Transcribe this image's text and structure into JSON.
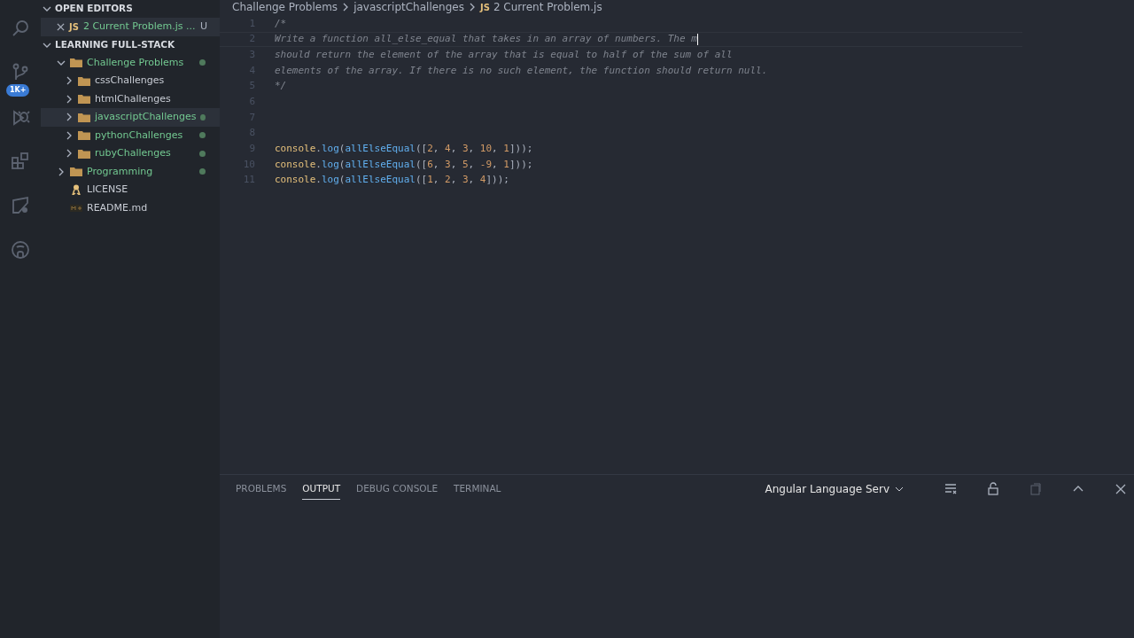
{
  "activity_bar": {
    "items": [
      {
        "kind": "search"
      },
      {
        "kind": "source-control",
        "badge": "1K+"
      },
      {
        "kind": "debug"
      },
      {
        "kind": "extensions"
      },
      {
        "kind": "remote"
      },
      {
        "kind": "github"
      }
    ]
  },
  "sidebar": {
    "open_editors": {
      "title": "OPEN EDITORS",
      "expanded": true,
      "items": [
        {
          "icon": "JS",
          "name": "2 Current Problem.js ...",
          "status": "U",
          "modified": true
        }
      ]
    },
    "explorer": {
      "title": "LEARNING FULL-STACK",
      "expanded": true,
      "items": [
        {
          "kind": "folder",
          "name": "Challenge Problems",
          "expanded": true,
          "modified": true,
          "selected": false,
          "children": [
            {
              "kind": "folder",
              "name": "cssChallenges",
              "expanded": false,
              "modified": false,
              "selected": false
            },
            {
              "kind": "folder",
              "name": "htmlChallenges",
              "expanded": false,
              "modified": false,
              "selected": false
            },
            {
              "kind": "folder",
              "name": "javascriptChallenges",
              "expanded": false,
              "modified": true,
              "selected": true
            },
            {
              "kind": "folder",
              "name": "pythonChallenges",
              "expanded": false,
              "modified": true,
              "selected": false
            },
            {
              "kind": "folder",
              "name": "rubyChallenges",
              "expanded": false,
              "modified": true,
              "selected": false
            }
          ]
        },
        {
          "kind": "folder",
          "name": "Programming",
          "expanded": false,
          "modified": true,
          "selected": false
        },
        {
          "kind": "license",
          "name": "LICENSE",
          "modified": false,
          "selected": false
        },
        {
          "kind": "markdown",
          "name": "README.md",
          "modified": false,
          "selected": false
        }
      ]
    }
  },
  "breadcrumbs": {
    "items": [
      "Challenge Problems",
      "javascriptChallenges"
    ],
    "file_icon": "JS",
    "file": "2 Current Problem.js"
  },
  "editor": {
    "lines": [
      {
        "number": "1",
        "current": false,
        "tokens": [
          {
            "kind": "comment",
            "text": "/*"
          }
        ]
      },
      {
        "number": "2",
        "current": true,
        "tokens": [
          {
            "kind": "comment",
            "text": "Write a function all_else_equal that takes in an array of numbers. The m"
          }
        ]
      },
      {
        "number": "3",
        "current": false,
        "tokens": [
          {
            "kind": "comment",
            "text": "should return the element of the array that is equal to half of the sum of all"
          }
        ]
      },
      {
        "number": "4",
        "current": false,
        "tokens": [
          {
            "kind": "comment",
            "text": "elements of the array. If there is no such element, the function should return null."
          }
        ]
      },
      {
        "number": "5",
        "current": false,
        "tokens": [
          {
            "kind": "comment",
            "text": "*/"
          }
        ]
      },
      {
        "number": "6",
        "current": false
      },
      {
        "number": "7",
        "current": false
      },
      {
        "number": "8",
        "current": false
      },
      {
        "number": "9",
        "current": false,
        "tokens": [
          {
            "kind": "object",
            "text": "console"
          },
          {
            "kind": "plain",
            "text": "."
          },
          {
            "kind": "function",
            "text": "log"
          },
          {
            "kind": "plain",
            "text": "("
          },
          {
            "kind": "function",
            "text": "allElseEqual"
          },
          {
            "kind": "plain",
            "text": "(["
          },
          {
            "kind": "number",
            "text": "2"
          },
          {
            "kind": "plain",
            "text": ", "
          },
          {
            "kind": "number",
            "text": "4"
          },
          {
            "kind": "plain",
            "text": ", "
          },
          {
            "kind": "number",
            "text": "3"
          },
          {
            "kind": "plain",
            "text": ", "
          },
          {
            "kind": "number",
            "text": "10"
          },
          {
            "kind": "plain",
            "text": ", "
          },
          {
            "kind": "number",
            "text": "1"
          },
          {
            "kind": "plain",
            "text": "]));"
          }
        ]
      },
      {
        "number": "10",
        "current": false,
        "tokens": [
          {
            "kind": "object",
            "text": "console"
          },
          {
            "kind": "plain",
            "text": "."
          },
          {
            "kind": "function",
            "text": "log"
          },
          {
            "kind": "plain",
            "text": "("
          },
          {
            "kind": "function",
            "text": "allElseEqual"
          },
          {
            "kind": "plain",
            "text": "(["
          },
          {
            "kind": "number",
            "text": "6"
          },
          {
            "kind": "plain",
            "text": ", "
          },
          {
            "kind": "number",
            "text": "3"
          },
          {
            "kind": "plain",
            "text": ", "
          },
          {
            "kind": "number",
            "text": "5"
          },
          {
            "kind": "plain",
            "text": ", "
          },
          {
            "kind": "number",
            "text": "-9"
          },
          {
            "kind": "plain",
            "text": ", "
          },
          {
            "kind": "number",
            "text": "1"
          },
          {
            "kind": "plain",
            "text": "]));"
          }
        ]
      },
      {
        "number": "11",
        "current": false,
        "tokens": [
          {
            "kind": "object",
            "text": "console"
          },
          {
            "kind": "plain",
            "text": "."
          },
          {
            "kind": "function",
            "text": "log"
          },
          {
            "kind": "plain",
            "text": "("
          },
          {
            "kind": "function",
            "text": "allElseEqual"
          },
          {
            "kind": "plain",
            "text": "(["
          },
          {
            "kind": "number",
            "text": "1"
          },
          {
            "kind": "plain",
            "text": ", "
          },
          {
            "kind": "number",
            "text": "2"
          },
          {
            "kind": "plain",
            "text": ", "
          },
          {
            "kind": "number",
            "text": "3"
          },
          {
            "kind": "plain",
            "text": ", "
          },
          {
            "kind": "number",
            "text": "4"
          },
          {
            "kind": "plain",
            "text": "]));"
          }
        ]
      }
    ]
  },
  "panel": {
    "tabs": [
      {
        "label": "PROBLEMS",
        "selected": false
      },
      {
        "label": "OUTPUT",
        "selected": true
      },
      {
        "label": "DEBUG CONSOLE",
        "selected": false
      },
      {
        "label": "TERMINAL",
        "selected": false
      }
    ],
    "channel": "Angular Language Serv",
    "actions": [
      {
        "kind": "clear"
      },
      {
        "kind": "lock"
      },
      {
        "kind": "copy"
      },
      {
        "kind": "maximize"
      },
      {
        "kind": "close"
      }
    ]
  }
}
